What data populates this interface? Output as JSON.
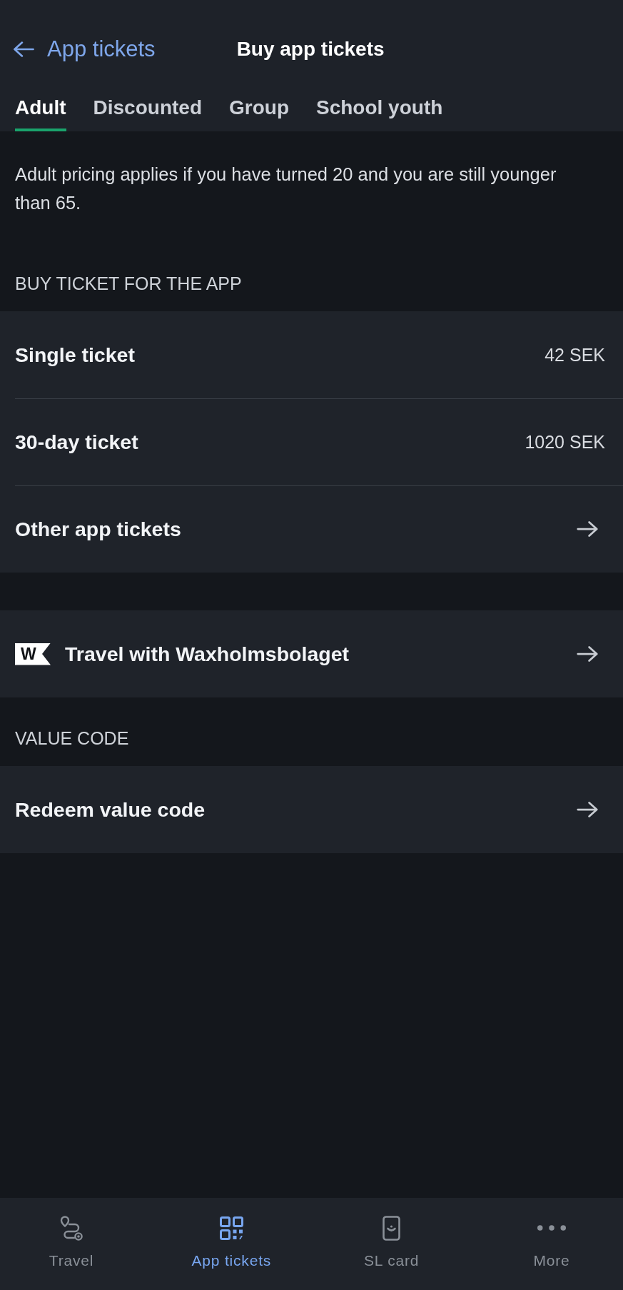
{
  "header": {
    "back_label": "App tickets",
    "title": "Buy app tickets"
  },
  "tabs": [
    {
      "label": "Adult",
      "selected": true
    },
    {
      "label": "Discounted",
      "selected": false
    },
    {
      "label": "Group",
      "selected": false
    },
    {
      "label": "School youth",
      "selected": false
    }
  ],
  "description": "Adult pricing applies if you have turned 20 and you are still younger than 65.",
  "sections": [
    {
      "heading": "BUY TICKET FOR THE APP",
      "items": [
        {
          "kind": "price",
          "label": "Single ticket",
          "price": "42 SEK"
        },
        {
          "kind": "price",
          "label": "30-day ticket",
          "price": "1020 SEK"
        },
        {
          "kind": "link",
          "label": "Other app tickets"
        }
      ]
    },
    {
      "items": [
        {
          "kind": "logo_link",
          "logo": "W",
          "label": "Travel with Waxholmsbolaget"
        }
      ]
    },
    {
      "heading": "VALUE CODE",
      "items": [
        {
          "kind": "link",
          "label": "Redeem value code"
        }
      ]
    }
  ],
  "bottom_nav": [
    {
      "kind": "route",
      "label": "Travel",
      "selected": false
    },
    {
      "kind": "qr",
      "label": "App tickets",
      "selected": true
    },
    {
      "kind": "card",
      "label": "SL card",
      "selected": false
    },
    {
      "kind": "more",
      "label": "More",
      "selected": false
    }
  ]
}
